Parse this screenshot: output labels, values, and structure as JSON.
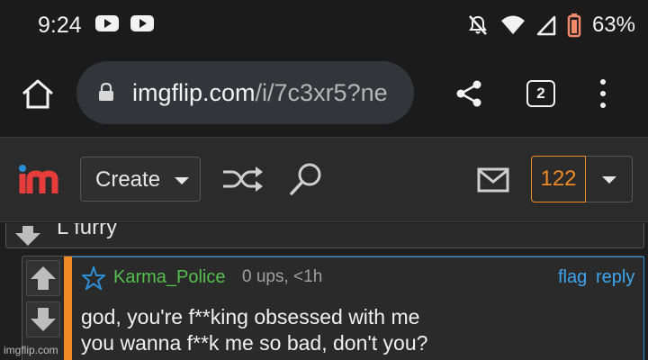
{
  "status_bar": {
    "time": "9:24",
    "battery": "63%",
    "icons": [
      "youtube-icon",
      "youtube-icon",
      "mute-icon",
      "wifi-icon",
      "signal-icon",
      "battery-icon"
    ]
  },
  "browser": {
    "url_host": "imgflip.com",
    "url_path": "/i/7c3xr5?ne",
    "tab_count": "2",
    "icons": [
      "home-icon",
      "lock-icon",
      "share-icon",
      "tabs-icon",
      "menu-icon"
    ]
  },
  "site_nav": {
    "create_label": "Create",
    "notification_count": "122",
    "accent_color": "#f08a24",
    "icons": [
      "imgflip-logo",
      "shuffle-icon",
      "search-icon",
      "mail-icon",
      "chevron-down-icon"
    ]
  },
  "comments": {
    "previous_text": "L furry",
    "comment": {
      "username": "Karma_Police",
      "meta": "0 ups, <1h",
      "flag_label": "flag",
      "reply_label": "reply",
      "line1": "god, you're f**king obsessed with me",
      "line2": "you wanna f**k me so bad, don't you?",
      "username_color": "#56c04f",
      "link_color": "#3ea6ef"
    }
  },
  "watermark": "imgflip.com"
}
